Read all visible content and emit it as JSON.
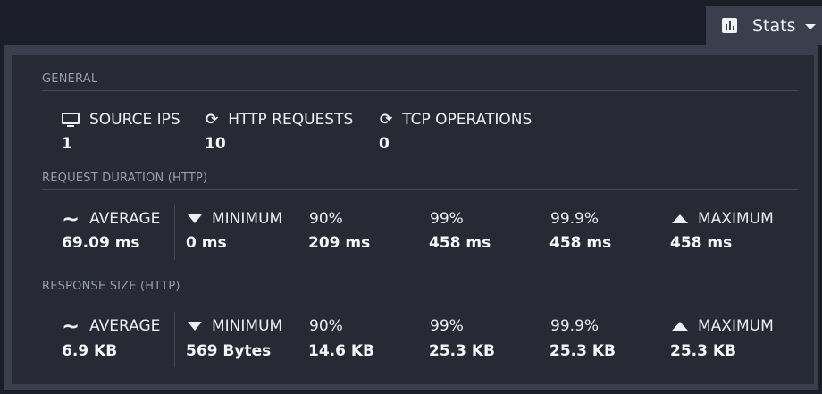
{
  "header": {
    "stats_label": "Stats"
  },
  "general": {
    "title": "GENERAL",
    "items": [
      {
        "label": "SOURCE IPS",
        "value": "1",
        "icon": "monitor-icon"
      },
      {
        "label": "HTTP REQUESTS",
        "value": "10",
        "icon": "refresh-icon"
      },
      {
        "label": "TCP OPERATIONS",
        "value": "0",
        "icon": "refresh-icon"
      }
    ]
  },
  "duration": {
    "title": "REQUEST DURATION (HTTP)",
    "average": {
      "label": "AVERAGE",
      "value": "69.09 ms"
    },
    "minimum": {
      "label": "MINIMUM",
      "value": "0 ms"
    },
    "p90": {
      "label": "90%",
      "value": "209 ms"
    },
    "p99": {
      "label": "99%",
      "value": "458 ms"
    },
    "p999": {
      "label": "99.9%",
      "value": "458 ms"
    },
    "maximum": {
      "label": "MAXIMUM",
      "value": "458 ms"
    }
  },
  "size": {
    "title": "RESPONSE SIZE (HTTP)",
    "average": {
      "label": "AVERAGE",
      "value": "6.9 KB"
    },
    "minimum": {
      "label": "MINIMUM",
      "value": "569 Bytes"
    },
    "p90": {
      "label": "90%",
      "value": "14.6 KB"
    },
    "p99": {
      "label": "99%",
      "value": "25.3 KB"
    },
    "p999": {
      "label": "99.9%",
      "value": "25.3 KB"
    },
    "maximum": {
      "label": "MAXIMUM",
      "value": "25.3 KB"
    }
  }
}
